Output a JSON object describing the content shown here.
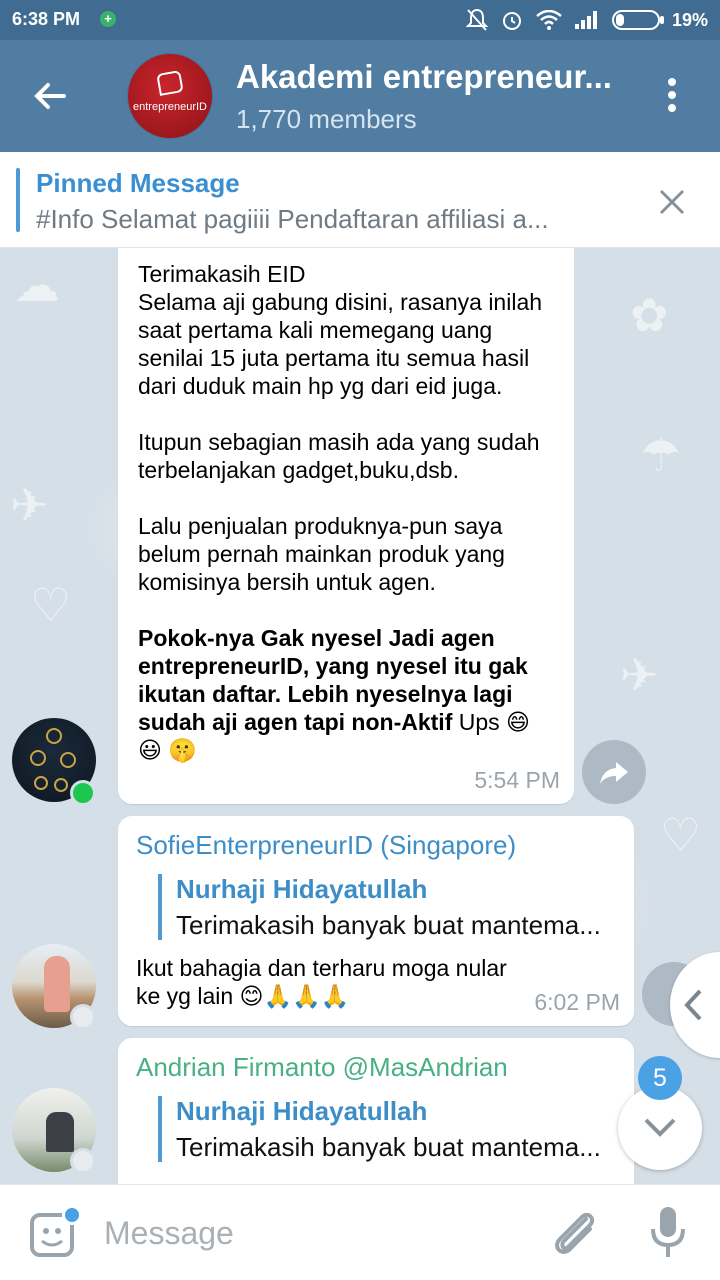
{
  "status_bar": {
    "time": "6:38 PM",
    "battery": "19%",
    "battery_level": 0.19
  },
  "header": {
    "title": "Akademi entrepreneur...",
    "subtitle": "1,770 members",
    "avatar_logo_text": "entrepreneurID"
  },
  "pinned": {
    "title": "Pinned Message",
    "text": "#Info  Selamat pagiiii  Pendaftaran affiliasi a..."
  },
  "messages": [
    {
      "paragraphs": [
        "Terimakasih EID\nSelama aji gabung disini, rasanya inilah saat pertama kali memegang uang senilai 15 juta pertama itu semua hasil dari duduk main hp yg dari eid juga.",
        "Itupun sebagian masih ada yang sudah terbelanjakan gadget,buku,dsb.",
        "Lalu penjualan produknya-pun saya belum pernah mainkan produk yang komisinya bersih untuk agen."
      ],
      "bold_text": "Pokok-nya Gak nyesel Jadi agen entrepreneurID, yang nyesel itu gak ikutan daftar. Lebih nyeselnya lagi sudah aji agen tapi non-Aktif",
      "tail_text": " Ups 😄😃 🤫",
      "time": "5:54 PM"
    },
    {
      "sender": "SofieEnterpreneurID (Singapore)",
      "reply_name": "Nurhaji Hidayatullah",
      "reply_text": "Terimakasih banyak buat mantema...",
      "text": "Ikut bahagia dan terharu moga nular ke yg lain 😊🙏🙏🙏",
      "time": "6:02 PM"
    },
    {
      "sender": "Andrian Firmanto @MasAndrian",
      "reply_name": "Nurhaji Hidayatullah",
      "reply_text": "Terimakasih banyak buat mantema..."
    }
  ],
  "unread_badge": "5",
  "input": {
    "placeholder": "Message"
  },
  "colors": {
    "header": "#517da2",
    "statusbar": "#406c92",
    "accent": "#4aa1e4",
    "online": "#1dc74f"
  }
}
